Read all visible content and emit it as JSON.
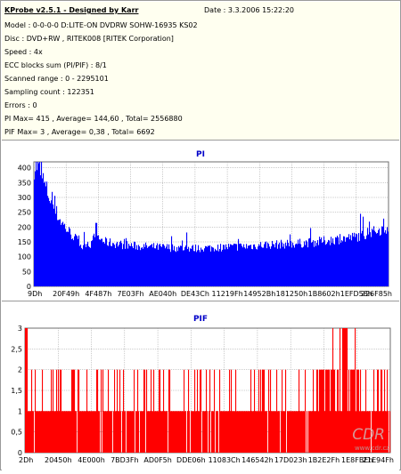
{
  "header": {
    "title": "KProbe v2.5.1 - Designed by Karr",
    "date": "Date : 3.3.2006 15:22:20"
  },
  "info_lines": [
    "Model : 0-0-0-0 D:LITE-ON DVDRW SOHW-16935 KS02",
    "Disc : DVD+RW , RITEK008 [RITEK Corporation]",
    "Speed : 4x",
    "ECC blocks sum (PI/PIF) : 8/1",
    "Scanned range : 0 - 2295101",
    "Sampling count : 122351",
    "Errors : 0",
    "PI Max= 415 , Average= 144,60 , Total= 2556880",
    "PIF Max= 3 , Average= 0,38 , Total= 6692"
  ],
  "watermark": "www.cdr.cz",
  "colors": {
    "pi": "#0000ff",
    "pif": "#ff0000",
    "title": "#0000c8",
    "plot_bg": "#ffffff",
    "info_bg": "#fffff0"
  },
  "chart_data": [
    {
      "type": "area",
      "title": "PI",
      "yticks": [
        "400",
        "350",
        "300",
        "250",
        "200",
        "150",
        "100",
        "50",
        "0"
      ],
      "xticks": [
        "9Dh",
        "20F49h",
        "4F487h",
        "7E03Fh",
        "AE040h",
        "DE43Ch",
        "11219Fh",
        "14952Bh",
        "181250h",
        "1B8602h",
        "1EFD58h",
        "226F85h"
      ],
      "ylim": [
        0,
        420
      ],
      "grid": true,
      "profile": [
        [
          0,
          405
        ],
        [
          0.006,
          410
        ],
        [
          0.015,
          395
        ],
        [
          0.03,
          340
        ],
        [
          0.05,
          280
        ],
        [
          0.07,
          230
        ],
        [
          0.09,
          195
        ],
        [
          0.11,
          170
        ],
        [
          0.125,
          150
        ],
        [
          0.135,
          135
        ],
        [
          0.14,
          125
        ],
        [
          0.148,
          155
        ],
        [
          0.155,
          140
        ],
        [
          0.165,
          150
        ],
        [
          0.175,
          205
        ],
        [
          0.18,
          165
        ],
        [
          0.2,
          150
        ],
        [
          0.25,
          140
        ],
        [
          0.3,
          135
        ],
        [
          0.35,
          132
        ],
        [
          0.4,
          130
        ],
        [
          0.45,
          128
        ],
        [
          0.5,
          130
        ],
        [
          0.55,
          133
        ],
        [
          0.6,
          135
        ],
        [
          0.65,
          140
        ],
        [
          0.7,
          142
        ],
        [
          0.75,
          145
        ],
        [
          0.8,
          150
        ],
        [
          0.85,
          158
        ],
        [
          0.9,
          165
        ],
        [
          0.95,
          180
        ],
        [
          1.0,
          200
        ]
      ]
    },
    {
      "type": "bar",
      "title": "PIF",
      "yticks": [
        "3",
        "2,5",
        "2",
        "1,5",
        "1",
        "0,5",
        "0"
      ],
      "xticks": [
        "2Dh",
        "20450h",
        "4E000h",
        "7BD3Fh",
        "AD0F5h",
        "DDE06h",
        "11083Ch",
        "146542h",
        "17D023h",
        "1B2E2Fh",
        "1E8FBEh",
        "21E94Fh"
      ],
      "ylim": [
        0,
        3
      ],
      "grid": true,
      "profile": [
        [
          0,
          1
        ],
        [
          0.8,
          1
        ],
        [
          0.82,
          2
        ],
        [
          0.88,
          2
        ],
        [
          0.92,
          1
        ],
        [
          1.0,
          1
        ]
      ]
    }
  ]
}
